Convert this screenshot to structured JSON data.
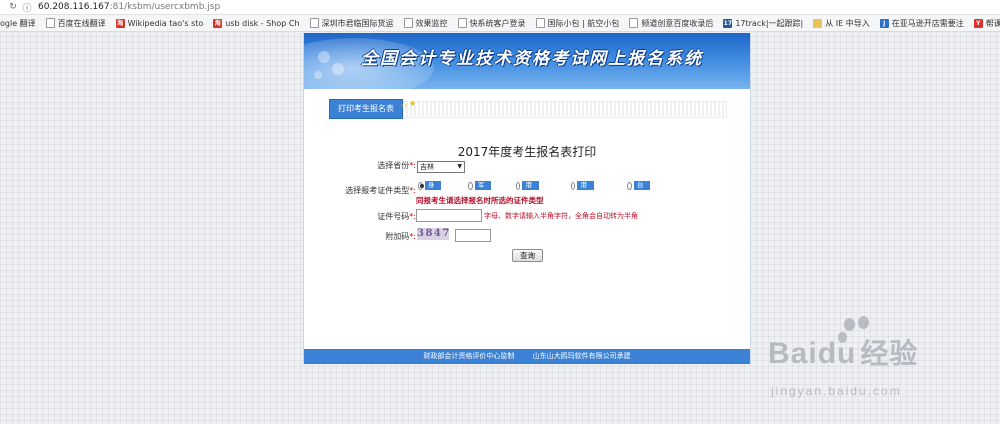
{
  "browser": {
    "url_host": "60.208.116.167",
    "url_path": ":81/ksbm/usercxbmb.jsp",
    "bookmarks": [
      {
        "label": "ogle 翻译",
        "icon": "google-icon"
      },
      {
        "label": "百度在线翻译",
        "icon": "page-icon"
      },
      {
        "label": "Wikipedia tao's sto",
        "icon": "taobao-icon"
      },
      {
        "label": "usb disk - Shop Ch",
        "icon": "taobao-icon"
      },
      {
        "label": "深圳市君临国际货运",
        "icon": "page-icon"
      },
      {
        "label": "效果监控",
        "icon": "page-icon"
      },
      {
        "label": "快系统客户登录",
        "icon": "page-icon"
      },
      {
        "label": "国际小包 | 航空小包",
        "icon": "page-icon"
      },
      {
        "label": "频道创意百度收录后",
        "icon": "page-icon"
      },
      {
        "label": "17track|一起跟踪|",
        "icon": "track-icon"
      },
      {
        "label": "从 IE 中导入",
        "icon": "folder-icon"
      },
      {
        "label": "在亚马逊开店需要注",
        "icon": "amazon-icon"
      },
      {
        "label": "帮课 - 跟一线外贸",
        "icon": "bangke-icon"
      }
    ]
  },
  "page": {
    "banner_title": "全国会计专业技术资格考试网上报名系统",
    "tab_print": "打印考生报名表",
    "heading": "2017年度考生报名表打印",
    "province_label": "选择省份",
    "province_value": "吉林",
    "id_type_label": "选择报考证件类型",
    "id_types": [
      "身份证",
      "军官证",
      "港澳居民",
      "港居民证",
      "台胞证"
    ],
    "warning": "同报考生请选择报名时所选的证件类型",
    "id_number_label": "证件号码",
    "id_number_hint": "字母、数字请输入半角字符，全角会自动转为半角",
    "captcha_label": "附加码",
    "captcha_code": "3847",
    "query_button": "查询",
    "footer_left": "财政部会计资格评价中心监制",
    "footer_right": "山东山大鸥玛软件有限公司承建",
    "required_mark": "*:"
  },
  "watermark": {
    "brand": "Bai",
    "brand_tail": "du",
    "brand_cn": "经验",
    "sub": "jingyan.baidu.com"
  },
  "colors": {
    "accent_blue": "#3b82d6",
    "warning_red": "#b0102a"
  }
}
